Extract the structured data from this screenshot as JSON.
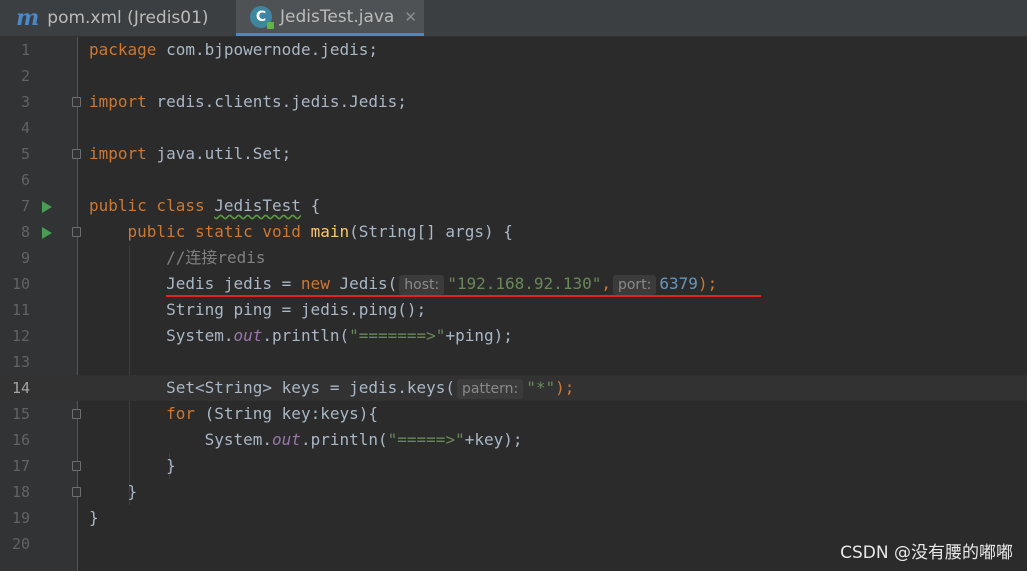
{
  "tabs": [
    {
      "label": "pom.xml (Jredis01)",
      "icon": "maven-m-icon"
    },
    {
      "label": "JedisTest.java",
      "icon": "java-class-c-icon",
      "active": true
    }
  ],
  "lines": {
    "l1": {
      "n": "1",
      "kw": "package",
      "rest": "com.bjpowernode.jedis;"
    },
    "l2": {
      "n": "2"
    },
    "l3": {
      "n": "3",
      "kw": "import",
      "rest": "redis.clients.jedis.Jedis;"
    },
    "l4": {
      "n": "4"
    },
    "l5": {
      "n": "5",
      "kw": "import",
      "rest": "java.util.Set;"
    },
    "l6": {
      "n": "6"
    },
    "l7": {
      "n": "7",
      "kw": "public class",
      "cls": "JedisTest",
      "rest": "{"
    },
    "l8": {
      "n": "8",
      "kw": "public static void",
      "fn": "main",
      "rest": "(String[] args) {"
    },
    "l9": {
      "n": "9",
      "comment": "//连接redis"
    },
    "l10": {
      "n": "10",
      "pre": "Jedis jedis = ",
      "kw": "new",
      "mid": "Jedis(",
      "hint1": "host:",
      "str": "\"192.168.92.130\"",
      "comma": ",",
      "hint2": "port:",
      "num": "6379",
      "end": ");"
    },
    "l11": {
      "n": "11",
      "text": "String ping = jedis.ping();"
    },
    "l12": {
      "n": "12",
      "pre": "System.",
      "fld": "out",
      "mid": ".println(",
      "str": "\"=======>\"",
      "end": "+ping);"
    },
    "l13": {
      "n": "13"
    },
    "l14": {
      "n": "14",
      "pre": "Set<String> keys = jedis.keys(",
      "hint": "pattern:",
      "str": "\"*\"",
      "end": ");"
    },
    "l15": {
      "n": "15",
      "kw": "for",
      "rest": "(String key:keys){"
    },
    "l16": {
      "n": "16",
      "pre": "System.",
      "fld": "out",
      "mid": ".println(",
      "str": "\"=====>\"",
      "end": "+key);"
    },
    "l17": {
      "n": "17",
      "text": "}"
    },
    "l18": {
      "n": "18",
      "text": "}"
    },
    "l19": {
      "n": "19",
      "text": "}"
    },
    "l20": {
      "n": "20"
    }
  },
  "watermark": "CSDN @没有腰的嘟嘟"
}
